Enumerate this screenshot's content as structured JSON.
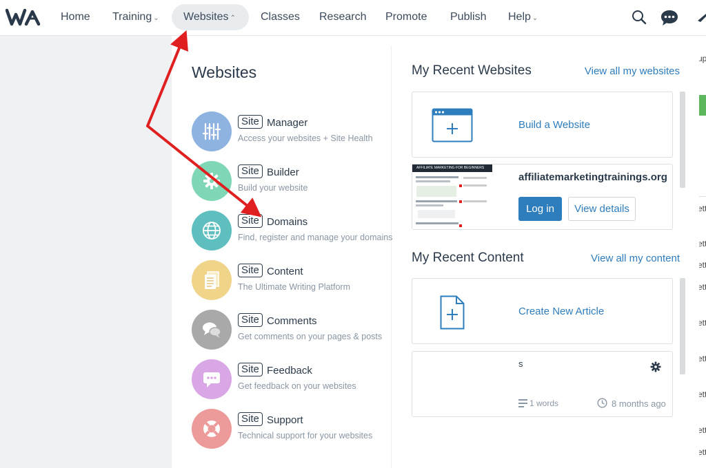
{
  "nav": {
    "logo": "WA",
    "items": [
      {
        "label": "Home"
      },
      {
        "label": "Training",
        "chevron": "⌄"
      },
      {
        "label": "Websites",
        "chevron": "⌃"
      },
      {
        "label": "Classes"
      },
      {
        "label": "Research"
      },
      {
        "label": "Promote"
      },
      {
        "label": "Publish"
      },
      {
        "label": "Help",
        "chevron": "⌄"
      }
    ],
    "icons": [
      "search-icon",
      "chat-icon",
      "notification-icon"
    ]
  },
  "panel": {
    "title": "Websites",
    "tools": [
      {
        "badge": "Site",
        "name": "Manager",
        "desc": "Access your websites + Site Health",
        "color": "#8fb3e0",
        "icon": "sliders-icon"
      },
      {
        "badge": "Site",
        "name": "Builder",
        "desc": "Build your website",
        "color": "#7fd7b5",
        "icon": "gear-icon"
      },
      {
        "badge": "Site",
        "name": "Domains",
        "desc": "Find, register and manage your domains",
        "color": "#5fbfbf",
        "icon": "globe-icon"
      },
      {
        "badge": "Site",
        "name": "Content",
        "desc": "The Ultimate Writing Platform",
        "color": "#f0d48a",
        "icon": "document-icon"
      },
      {
        "badge": "Site",
        "name": "Comments",
        "desc": "Get comments on your pages & posts",
        "color": "#a9a9a9",
        "icon": "comments-icon"
      },
      {
        "badge": "Site",
        "name": "Feedback",
        "desc": "Get feedback on your websites",
        "color": "#d9a6e6",
        "icon": "feedback-icon"
      },
      {
        "badge": "Site",
        "name": "Support",
        "desc": "Technical support for your websites",
        "color": "#ec9a9a",
        "icon": "lifebuoy-icon"
      }
    ]
  },
  "recent_websites": {
    "title": "My Recent Websites",
    "view_all": "View all my websites",
    "build_label": "Build a Website",
    "site": {
      "name": "affiliatemarketingtrainings.org",
      "thumb_header": "AFFILIATE MARKETING FOR BEGINNERS",
      "login_label": "Log in",
      "details_label": "View details"
    }
  },
  "recent_content": {
    "title": "My Recent Content",
    "view_all": "View all my content",
    "create_label": "Create New Article",
    "article": {
      "title": "s",
      "words": "1 words",
      "time": "8 months ago"
    }
  },
  "background": {
    "fragments": [
      "up",
      "ett",
      "ett",
      "ett",
      "ett",
      "ett",
      "ett",
      "ett",
      "ett",
      "ett"
    ]
  },
  "colors": {
    "accent": "#2e7dbd",
    "arrow": "#e02020"
  }
}
